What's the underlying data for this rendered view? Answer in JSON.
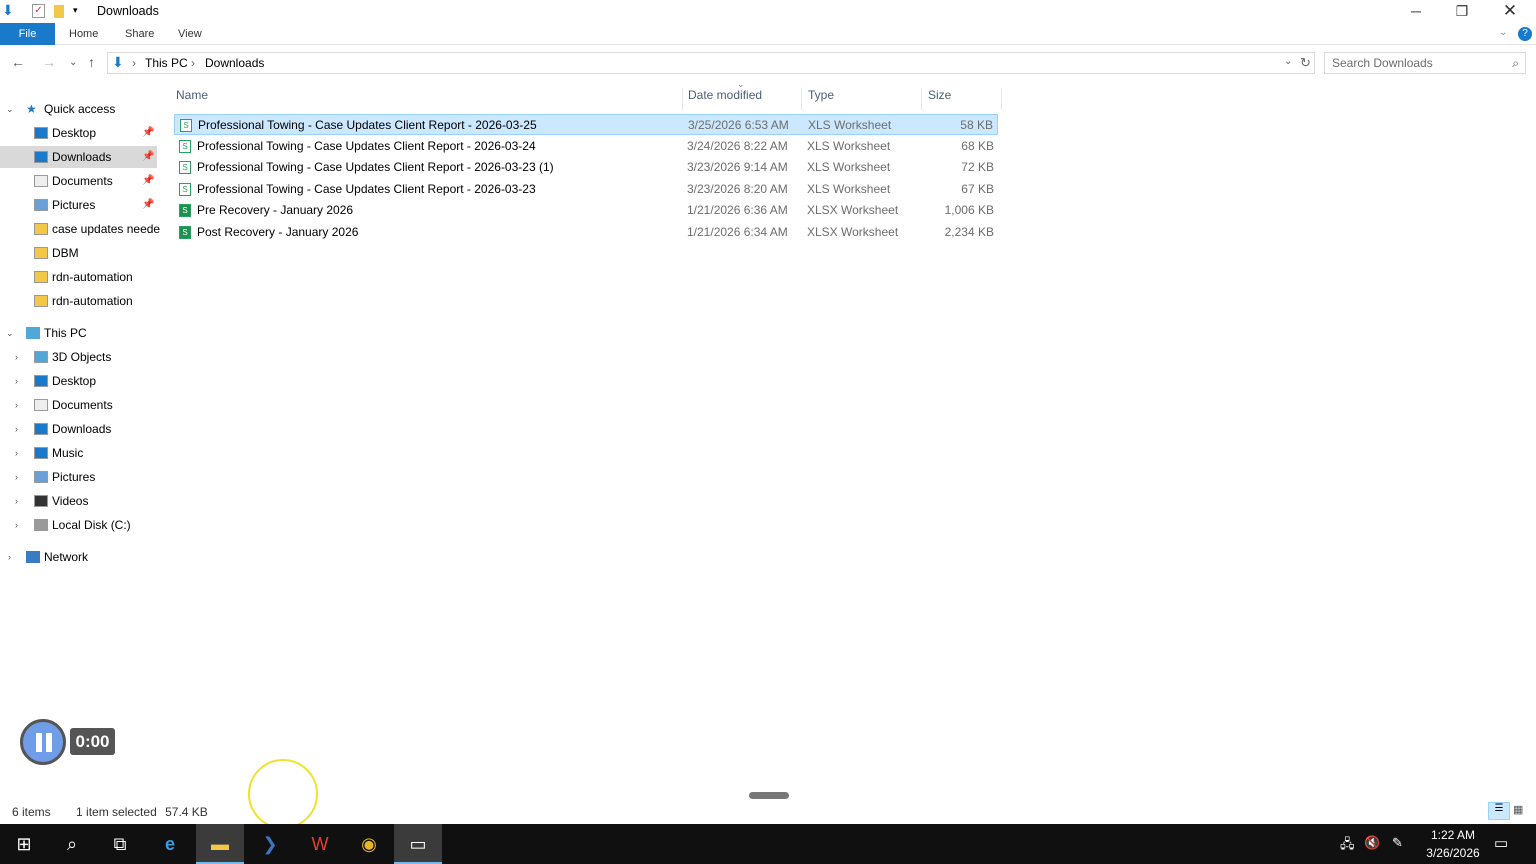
{
  "window": {
    "title": "Downloads"
  },
  "ribbon": {
    "file": "File",
    "home": "Home",
    "share": "Share",
    "view": "View"
  },
  "address": {
    "crumbs": [
      "This PC",
      "Downloads"
    ]
  },
  "search": {
    "placeholder": "Search Downloads"
  },
  "nav": {
    "quick_access": "Quick access",
    "quick": [
      {
        "label": "Desktop",
        "pinned": true
      },
      {
        "label": "Downloads",
        "pinned": true,
        "selected": true
      },
      {
        "label": "Documents",
        "pinned": true
      },
      {
        "label": "Pictures",
        "pinned": true
      },
      {
        "label": "case updates neede"
      },
      {
        "label": "DBM"
      },
      {
        "label": "rdn-automation"
      },
      {
        "label": "rdn-automation"
      }
    ],
    "this_pc": "This PC",
    "pc": [
      {
        "label": "3D Objects"
      },
      {
        "label": "Desktop"
      },
      {
        "label": "Documents"
      },
      {
        "label": "Downloads"
      },
      {
        "label": "Music"
      },
      {
        "label": "Pictures"
      },
      {
        "label": "Videos"
      },
      {
        "label": "Local Disk (C:)"
      }
    ],
    "network": "Network"
  },
  "columns": {
    "name": "Name",
    "date": "Date modified",
    "type": "Type",
    "size": "Size"
  },
  "files": [
    {
      "name": "Professional Towing - Case Updates Client Report - 2026-03-25",
      "date": "3/25/2026 6:53 AM",
      "type": "XLS Worksheet",
      "size": "58 KB",
      "selected": true
    },
    {
      "name": "Professional Towing - Case Updates Client Report - 2026-03-24",
      "date": "3/24/2026 8:22 AM",
      "type": "XLS Worksheet",
      "size": "68 KB"
    },
    {
      "name": "Professional Towing - Case Updates Client Report - 2026-03-23 (1)",
      "date": "3/23/2026 9:14 AM",
      "type": "XLS Worksheet",
      "size": "72 KB"
    },
    {
      "name": "Professional Towing - Case Updates Client Report - 2026-03-23",
      "date": "3/23/2026 8:20 AM",
      "type": "XLS Worksheet",
      "size": "67 KB"
    },
    {
      "name": "Pre Recovery - January 2026",
      "date": "1/21/2026 6:36 AM",
      "type": "XLSX Worksheet",
      "size": "1,006 KB"
    },
    {
      "name": "Post Recovery - January 2026",
      "date": "1/21/2026 6:34 AM",
      "type": "XLSX Worksheet",
      "size": "2,234 KB"
    }
  ],
  "status": {
    "items": "6 items",
    "selected": "1 item selected",
    "size": "57.4 KB"
  },
  "recorder": {
    "time": "0:00"
  },
  "clock": {
    "time": "1:22 AM",
    "date": "3/26/2026"
  }
}
